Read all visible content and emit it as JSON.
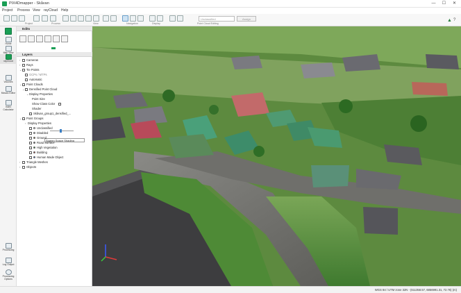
{
  "window": {
    "title": "PIX4Dmapper - Skåvan",
    "minimize": "—",
    "maximize": "☐",
    "close": "✕"
  },
  "menu": [
    "Project",
    "Process",
    "View",
    "rayCloud",
    "Help"
  ],
  "ribbon": {
    "groups": [
      "Project",
      "Process",
      "View",
      "Navigation",
      "Display",
      "Point Cloud Editing"
    ],
    "class_input_placeholder": "Unclassified",
    "assign_label": "Assign"
  },
  "leftbar": [
    {
      "label": "Home",
      "icon": "home-icon"
    },
    {
      "label": "Map View",
      "icon": "map-icon"
    },
    {
      "label": "rayCloud",
      "icon": "raycloud-icon",
      "active": true
    },
    {
      "label": "Volumes",
      "icon": "volumes-icon"
    },
    {
      "label": "Mosaic Editor",
      "icon": "mosaic-icon"
    },
    {
      "label": "Index Calculator",
      "icon": "index-icon"
    },
    {
      "label": "Processing",
      "icon": "processing-icon"
    },
    {
      "label": "Log Output",
      "icon": "log-icon"
    },
    {
      "label": "Processing Options",
      "icon": "options-icon"
    }
  ],
  "panel": {
    "edits_title": "Edits",
    "layers_title": "Layers",
    "tree": [
      {
        "label": "Cameras",
        "level": 1
      },
      {
        "label": "Rays",
        "level": 1
      },
      {
        "label": "Tie Points",
        "level": 1
      },
      {
        "label": "GCPs / MTPs",
        "level": 2
      },
      {
        "label": "Automatic",
        "level": 2
      },
      {
        "label": "Point Clouds",
        "level": 1
      },
      {
        "label": "Densified Point Cloud",
        "level": 2
      },
      {
        "label": "Display Properties",
        "level": 3
      },
      {
        "label": "Point Size",
        "level": 4
      },
      {
        "label": "Show Class Color",
        "level": 4
      },
      {
        "label": "Shader",
        "level": 4
      },
      {
        "label": "Skåvan_group1_densified_...",
        "level": 3
      },
      {
        "label": "Point Groups",
        "level": 1
      },
      {
        "label": "Display Properties",
        "level": 2
      },
      {
        "label": "Unclassified",
        "level": 3
      },
      {
        "label": "Disabled",
        "level": 3
      },
      {
        "label": "Ground",
        "level": 3
      },
      {
        "label": "Road Surface",
        "level": 3
      },
      {
        "label": "High Vegetation",
        "level": 3
      },
      {
        "label": "Building",
        "level": 3
      },
      {
        "label": "Human Made Object",
        "level": 3
      },
      {
        "label": "Triangle Meshes",
        "level": 1
      },
      {
        "label": "Objects",
        "level": 1
      }
    ],
    "shader_value": "Screen Space Shading",
    "point_size": 0.4,
    "class_colors": {
      "Unclassified": "#ffffff",
      "Disabled": "#dddddd",
      "Ground": "#8b6b2e",
      "Road Surface": "#707070",
      "High Vegetation": "#2f8f2f",
      "Building": "#c03030",
      "Human Made Object": "#3f6fdf"
    }
  },
  "status": {
    "coords": "WGS 84 / UTM zone 32N - (611358.57, 6856991.31, 72.76) (m)"
  },
  "colors": {
    "brand": "#1a9e55",
    "selection": "#cfe3f3"
  }
}
